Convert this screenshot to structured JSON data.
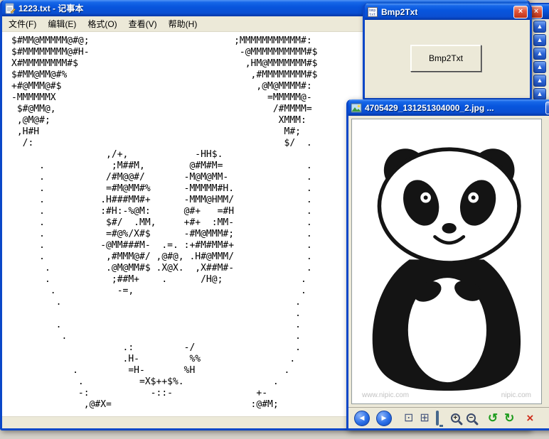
{
  "colors": {
    "titlebar_blue": "#0855dd",
    "chrome_gray": "#ece9d8",
    "close_red": "#d6492b",
    "rotate_green": "#1e9c1e",
    "nav_blue": "#2a6fe8"
  },
  "notepad": {
    "title": "1223.txt - 记事本",
    "menus": [
      {
        "label": "文件(F)"
      },
      {
        "label": "编辑(E)"
      },
      {
        "label": "格式(O)"
      },
      {
        "label": "查看(V)"
      },
      {
        "label": "帮助(H)"
      }
    ],
    "ascii_art": [
      "$#MM@MMMMM@#@;                          ;MMMMMMMMMMM#:",
      "$#MMMMMMMM@#H-                           -@MMMMMMMMMM#$",
      "X#MMMMMMMM#$                              ,HM@MMMMMMM#$",
      "$#MM@MM@#%                                 ,#MMMMMMMM#$",
      "+#@MMM@#$                                   ,@M@MMMM#:",
      "-MMMMMMX                                      =MMMMM@-",
      " $#@MM@,                                       /#MMMM=",
      " ,@M@#;                                         XMMM:",
      " ,H#H                                            M#;",
      "  /:                                             $/  .",
      "                 ,/+,            -HH$.",
      "     .            ;M##M,        @#M#M=               .",
      "     .           /#M@@#/       -M@M@MM-              .",
      "     .           =#M@MM#%      -MMMMM#H.             .",
      "     .          .H###MM#+      -MMM@HMM/             .",
      "     .          :#H:-%@M:      @#+   =#H             .",
      "     .           $#/  .MM,     +#+  :MM-             .",
      "     .           =#@%/X#$      -#M@MMM#;             .",
      "     .          -@MM###M-  .=. :+#M#MM#+             .",
      "     .           ,#MMM@#/ ,@#@, .H#@MMM/             .",
      "      .          .@M@MM#$ .X@X.  ,X##M#-             .",
      "      .           ;##M+    .      /H@;              .",
      "       .           -=,                              .",
      "        .                                          .",
      "                                                   .",
      "        .                                          .",
      "         .                                         .",
      "                    .:         -/                  .",
      "                    .H-         %%                .",
      "           .         =H-       %H                .",
      "            .          =X$++$%.                .",
      "            -:           -::-               +-",
      "             ,@#X=                         :@#M;"
    ]
  },
  "bmp2txt": {
    "title": "Bmp2Txt",
    "convert_button": "Bmp2Txt",
    "close_glyph": "×"
  },
  "viewer": {
    "title": "4705429_131251304000_2.jpg ...",
    "minimize_glyph": "_",
    "maximize_glyph": "□",
    "watermark_left": "www.nipic.com",
    "watermark_right": "nipic.com",
    "toolbar": {
      "prev_glyph": "◀",
      "next_glyph": "▶",
      "best_fit_glyph": "⊡",
      "actual_size_glyph": "⊞",
      "zoom_in_glyph": "+",
      "zoom_out_glyph": "−",
      "rotate_ccw_glyph": "↺",
      "rotate_cw_glyph": "↻",
      "delete_glyph": "×"
    }
  },
  "edge_panel": {
    "close_glyph": "×",
    "scroll_up_glyph": "▲"
  }
}
